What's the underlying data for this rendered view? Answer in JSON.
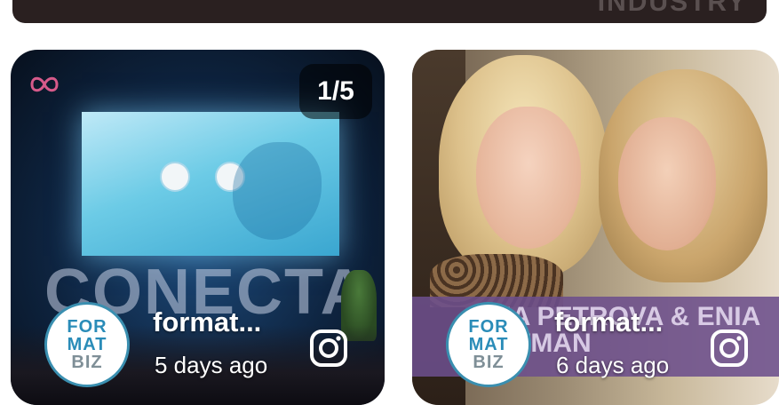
{
  "top_banner": {
    "text": "INDUSTRY"
  },
  "cards": [
    {
      "counter": "1/5",
      "screen_caption": "CONECTA",
      "avatar_lines": [
        "FOR",
        "MAT",
        "BIZ"
      ],
      "account_name": "format...",
      "time_ago": "5 days ago",
      "social_icon": "instagram-icon"
    },
    {
      "banner_text": "ENA PETROVA & ENIA GUTMAN",
      "avatar_lines": [
        "FOR",
        "MAT",
        "BIZ"
      ],
      "account_name": "format...",
      "time_ago": "6 days ago",
      "social_icon": "instagram-icon"
    }
  ],
  "colors": {
    "top_banner_bg": "#2a2020",
    "avatar_accent": "#2a8cb8",
    "banner_purple": "#6c4e8c",
    "text_on_media": "#ffffff"
  }
}
